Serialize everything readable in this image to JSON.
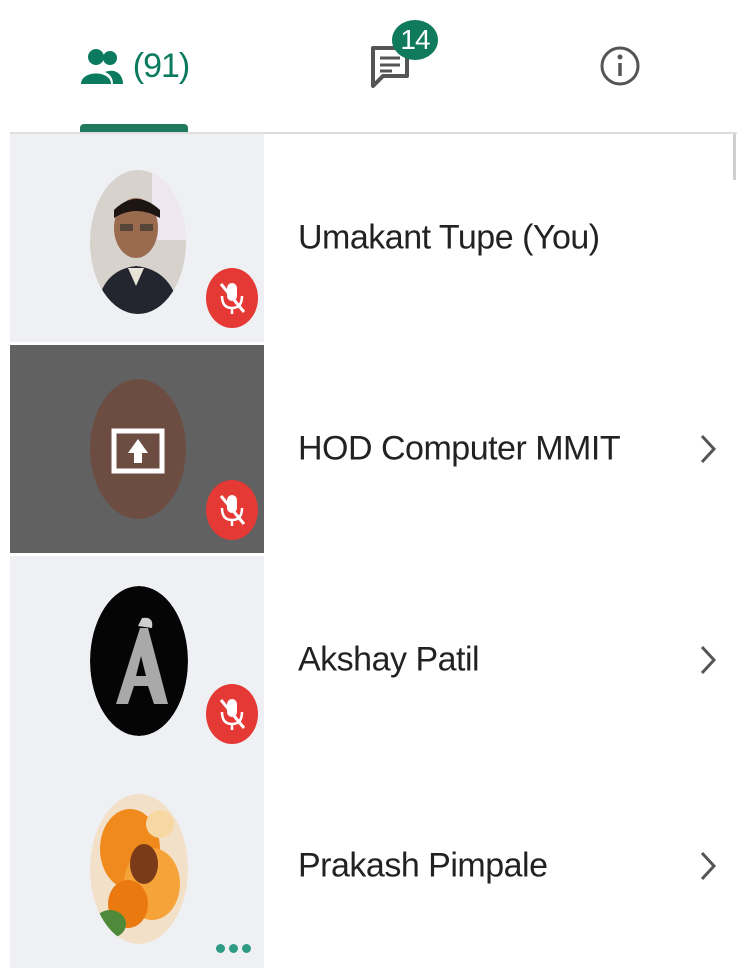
{
  "tabs": {
    "people_count": "(91)",
    "chat_badge": "14"
  },
  "participants": [
    {
      "name": "Umakant Tupe (You)",
      "muted": true,
      "active": false,
      "avatar": "photo-man"
    },
    {
      "name": "HOD Computer MMIT",
      "muted": true,
      "active": true,
      "avatar": "screen-share-icon"
    },
    {
      "name": "Akshay Patil",
      "muted": true,
      "active": false,
      "avatar": "logo-a"
    },
    {
      "name": "Prakash Pimpale",
      "muted": false,
      "active": false,
      "avatar": "photo-flowers",
      "more": true
    }
  ],
  "colors": {
    "accent": "#1f7a5e",
    "badge": "#0f7a5c",
    "mute": "#e53935",
    "active_row": "#616161",
    "row_left": "#eef0f3"
  }
}
